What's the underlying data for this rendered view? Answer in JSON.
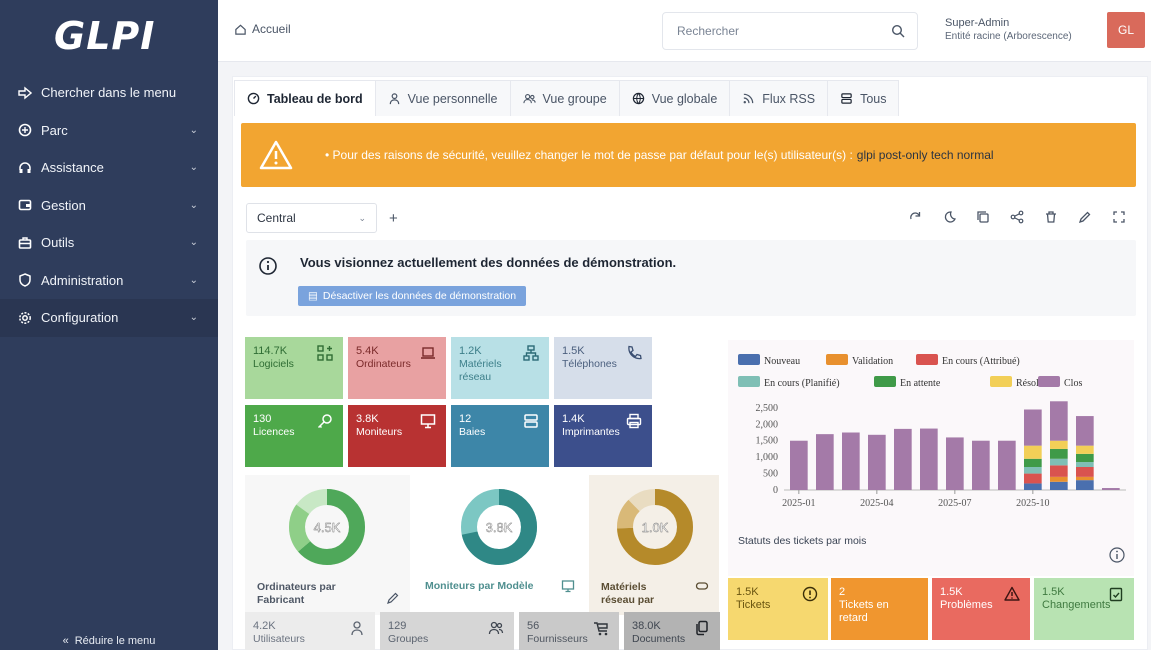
{
  "app": {
    "logo": "GLPI"
  },
  "sidebar": {
    "items": [
      {
        "label": "Chercher dans le menu",
        "icon": "search-menu-icon"
      },
      {
        "label": "Parc",
        "icon": "box-icon"
      },
      {
        "label": "Assistance",
        "icon": "headset-icon"
      },
      {
        "label": "Gestion",
        "icon": "wallet-icon"
      },
      {
        "label": "Outils",
        "icon": "briefcase-icon"
      },
      {
        "label": "Administration",
        "icon": "shield-icon"
      },
      {
        "label": "Configuration",
        "icon": "gear-icon"
      }
    ],
    "collapse_label": "Réduire le menu"
  },
  "header": {
    "breadcrumb": "Accueil",
    "search_placeholder": "Rechercher",
    "user_name": "Super-Admin",
    "user_entity": "Entité racine (Arborescence)",
    "avatar_initials": "GL"
  },
  "tabs": [
    {
      "label": "Tableau de bord",
      "active": true
    },
    {
      "label": "Vue personnelle"
    },
    {
      "label": "Vue groupe"
    },
    {
      "label": "Vue globale"
    },
    {
      "label": "Flux RSS"
    },
    {
      "label": "Tous"
    }
  ],
  "alert": {
    "text": "• Pour des raisons de sécurité, veuillez changer le mot de passe par défaut pour le(s) utilisateur(s) :",
    "users": "glpi post-only tech normal"
  },
  "dashboard": {
    "selected": "Central",
    "add_label": "+"
  },
  "demo": {
    "message": "Vous visionnez actuellement des données de démonstration.",
    "button": "Désactiver les données de démonstration"
  },
  "tiles": [
    {
      "num": "114.7K",
      "label": "Logiciels",
      "color": "#a8d89b",
      "text": "#2f6d34"
    },
    {
      "num": "5.4K",
      "label": "Ordinateurs",
      "color": "#e8a1a2",
      "text": "#7a2a2a"
    },
    {
      "num": "1.2K",
      "label": "Matériels réseau",
      "color": "#b8e0e6",
      "text": "#3d7f8a"
    },
    {
      "num": "1.5K",
      "label": "Téléphones",
      "color": "#d6deea",
      "text": "#4b5f7e"
    },
    {
      "num": "130",
      "label": "Licences",
      "color": "#4ea94a",
      "text": "#ffffff"
    },
    {
      "num": "3.8K",
      "label": "Moniteurs",
      "color": "#b83232",
      "text": "#ffffff"
    },
    {
      "num": "12",
      "label": "Baies",
      "color": "#3d86a8",
      "text": "#ffffff"
    },
    {
      "num": "1.4K",
      "label": "Imprimantes",
      "color": "#3c4f8c",
      "text": "#ffffff"
    }
  ],
  "donuts": [
    {
      "center": "4.5K",
      "title": "Ordinateurs par Fabricant",
      "color": "#4fa85a",
      "title_color": "#4f5866"
    },
    {
      "center": "3.8K",
      "title": "Moniteurs par Modèle",
      "color": "#3e9a98",
      "title_color": "#4f8f8f"
    },
    {
      "center": "1.0K",
      "title": "Matériels réseau par Statut",
      "color": "#b58a2a",
      "title_color": "#5a4d33"
    }
  ],
  "bottom_tiles": [
    {
      "num": "4.2K",
      "label": "Utilisateurs",
      "color": "#ececec"
    },
    {
      "num": "129",
      "label": "Groupes",
      "color": "#d6d6d6"
    },
    {
      "num": "56",
      "label": "Fournisseurs",
      "color": "#c9c9c9"
    },
    {
      "num": "38.0K",
      "label": "Documents",
      "color": "#b3b3b3"
    }
  ],
  "stats": [
    {
      "num": "1.5K",
      "label": "Tickets",
      "color": "#f6d86f",
      "text": "#6a5510"
    },
    {
      "num": "2",
      "label": "Tickets en retard",
      "color": "#f0962f",
      "text": "#ffffff"
    },
    {
      "num": "1.5K",
      "label": "Problèmes",
      "color": "#e96a60",
      "text": "#ffffff"
    },
    {
      "num": "1.5K",
      "label": "Changements",
      "color": "#b8e3b2",
      "text": "#3f7a40"
    }
  ],
  "chart_data": {
    "type": "bar",
    "title": "Statuts des tickets par mois",
    "legend": [
      {
        "name": "Nouveau",
        "color": "#4a6fae"
      },
      {
        "name": "Validation",
        "color": "#e8902e"
      },
      {
        "name": "En cours (Attribué)",
        "color": "#d9534f"
      },
      {
        "name": "En cours (Planifié)",
        "color": "#7fbfb5"
      },
      {
        "name": "En attente",
        "color": "#3f9a48"
      },
      {
        "name": "Résolu",
        "color": "#f2cf57"
      },
      {
        "name": "Clos",
        "color": "#a47aa8"
      }
    ],
    "yticks": [
      "2,500",
      "2,000",
      "1,500",
      "1,000",
      "500",
      "0"
    ],
    "ylim": [
      0,
      2800
    ],
    "xticks": [
      "2025-01",
      "2025-04",
      "2025-07",
      "2025-10"
    ],
    "bars": [
      {
        "clos": 1500
      },
      {
        "clos": 1700
      },
      {
        "clos": 1750
      },
      {
        "clos": 1680
      },
      {
        "clos": 1860
      },
      {
        "clos": 1870
      },
      {
        "clos": 1600
      },
      {
        "clos": 1500
      },
      {
        "clos": 1500,
        "resolu": 0,
        "attente": 0,
        "planifie": 0,
        "attribue": 0,
        "nouveau": 0
      },
      {
        "nouveau": 200,
        "attribue": 300,
        "attente": 250,
        "resolu": 400,
        "planifie": 200,
        "clos": 1100
      },
      {
        "nouveau": 250,
        "attribue": 350,
        "validation": 150,
        "attente": 300,
        "resolu": 250,
        "planifie": 200,
        "clos": 1200
      },
      {
        "nouveau": 300,
        "attribue": 300,
        "validation": 100,
        "attente": 250,
        "resolu": 250,
        "planifie": 150,
        "clos": 900
      },
      {
        "clos": 60
      }
    ]
  }
}
